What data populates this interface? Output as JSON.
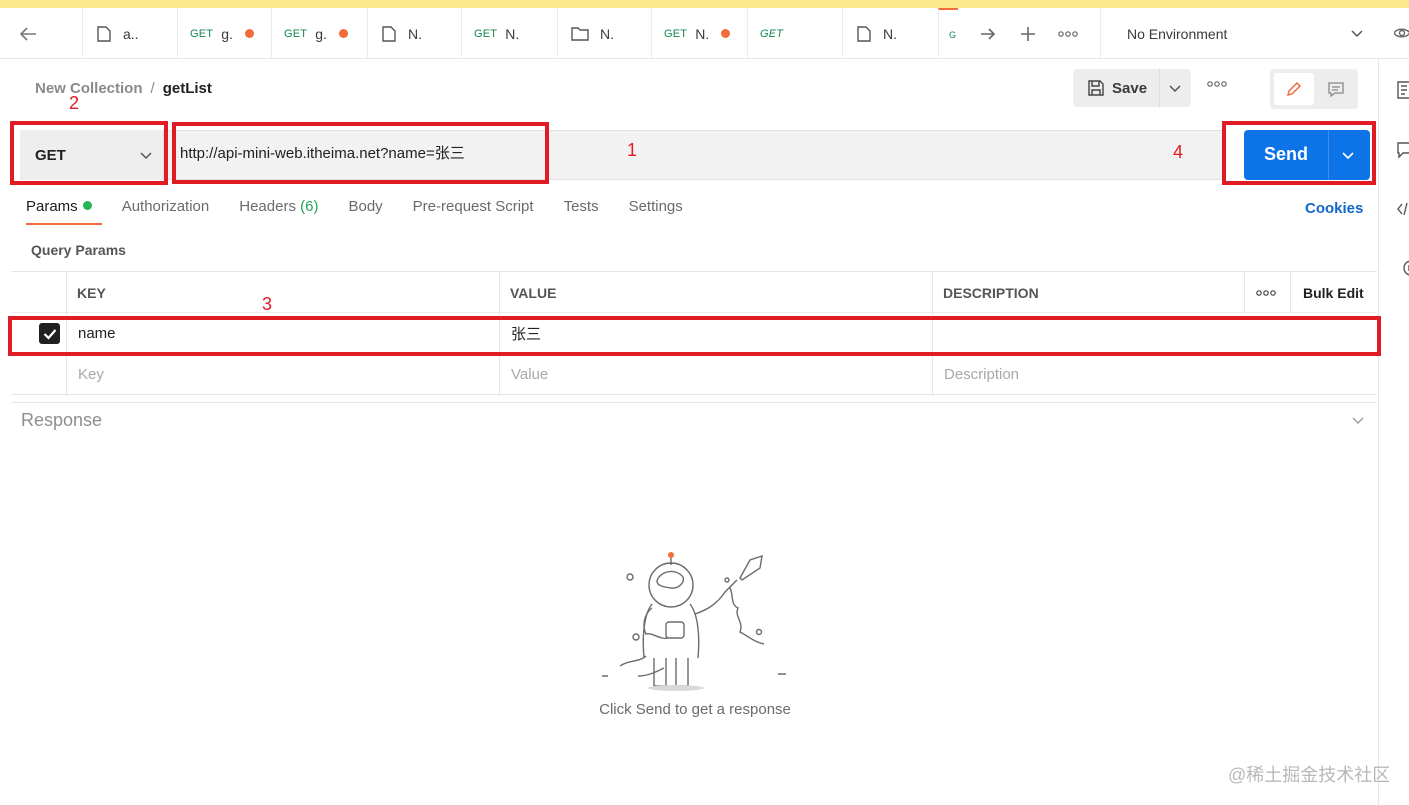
{
  "tabbar": {
    "tabs": [
      {
        "method": "",
        "label": "a..",
        "icon": "document-icon",
        "unsaved": false
      },
      {
        "method": "GET",
        "label": "g.",
        "unsaved": true
      },
      {
        "method": "GET",
        "label": "g.",
        "unsaved": true
      },
      {
        "method": "",
        "label": "N.",
        "icon": "document-icon",
        "unsaved": false
      },
      {
        "method": "GET",
        "label": "N.",
        "unsaved": false
      },
      {
        "method": "",
        "label": "N.",
        "icon": "folder-icon",
        "unsaved": false
      },
      {
        "method": "GET",
        "label": "N.",
        "unsaved": true
      },
      {
        "method": "GET",
        "label": "",
        "unsaved": false
      },
      {
        "method": "",
        "label": "N.",
        "icon": "document-icon",
        "unsaved": false
      },
      {
        "method": "G",
        "label": "",
        "unsaved": false
      }
    ],
    "environment": "No Environment"
  },
  "breadcrumb": {
    "collection": "New Collection",
    "separator": "/",
    "request": "getList"
  },
  "toolbar": {
    "save_label": "Save"
  },
  "request": {
    "method": "GET",
    "url": "http://api-mini-web.itheima.net?name=张三",
    "send_label": "Send"
  },
  "req_tabs": {
    "params": "Params",
    "authorization": "Authorization",
    "headers": "Headers",
    "headers_count": "(6)",
    "body": "Body",
    "prerequest": "Pre-request Script",
    "tests": "Tests",
    "settings": "Settings",
    "cookies": "Cookies"
  },
  "query_params": {
    "title": "Query Params",
    "headers": {
      "key": "KEY",
      "value": "VALUE",
      "description": "DESCRIPTION",
      "bulk_edit": "Bulk Edit"
    },
    "rows": [
      {
        "checked": true,
        "key": "name",
        "value": "张三",
        "description": ""
      }
    ],
    "placeholders": {
      "key": "Key",
      "value": "Value",
      "description": "Description"
    }
  },
  "response": {
    "title": "Response",
    "empty_message": "Click Send to get a response"
  },
  "annotations": [
    "1",
    "2",
    "3",
    "4"
  ],
  "watermark": "@稀土掘金技术社区",
  "colors": {
    "accent_orange": "#f26b3a",
    "send_blue": "#0d74e7",
    "annotation_red": "#e01b24",
    "get_green": "#0f8a4f"
  }
}
